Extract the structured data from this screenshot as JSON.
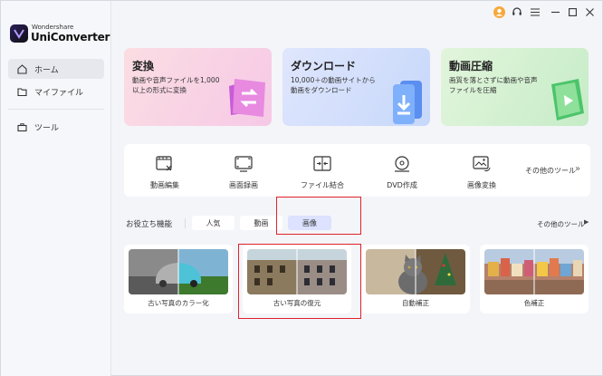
{
  "app": {
    "brand_small": "Wondershare",
    "brand_name": "UniConverter"
  },
  "sidebar": {
    "items": [
      {
        "label": "ホーム",
        "active": true,
        "icon": "home-icon"
      },
      {
        "label": "マイファイル",
        "active": false,
        "icon": "folder-icon"
      },
      {
        "label": "ツール",
        "active": false,
        "icon": "toolbox-icon"
      }
    ]
  },
  "titlebar": {
    "icons": [
      "user-icon",
      "headset-icon",
      "menu-icon",
      "minimize-icon",
      "maximize-icon",
      "close-icon"
    ]
  },
  "feature_cards": [
    {
      "title": "変換",
      "desc": "動画や音声ファイルを1,000以上の形式に変換",
      "bg": "#fbd9e1"
    },
    {
      "title": "ダウンロード",
      "desc": "10,000＋の動画サイトから動画をダウンロード",
      "bg": "#d7e3fb"
    },
    {
      "title": "動画圧縮",
      "desc": "画質を落とさずに動画や音声ファイルを圧縮",
      "bg": "#d8f3d9"
    }
  ],
  "tools": [
    {
      "label": "動画編集",
      "icon": "film-edit-icon"
    },
    {
      "label": "画面録画",
      "icon": "screen-record-icon"
    },
    {
      "label": "ファイル結合",
      "icon": "merge-icon"
    },
    {
      "label": "DVD作成",
      "icon": "dvd-icon"
    },
    {
      "label": "画像変換",
      "icon": "image-convert-icon"
    }
  ],
  "more_tools_label": "その他のツール",
  "useful_features": {
    "label": "お役立ち機能",
    "tabs": [
      {
        "label": "人気",
        "active": false
      },
      {
        "label": "動画",
        "active": false
      },
      {
        "label": "画像",
        "active": true
      }
    ],
    "other_tools_label": "その他のツール"
  },
  "photo_tools": [
    {
      "label": "古い写真のカラー化"
    },
    {
      "label": "古い写真の復元"
    },
    {
      "label": "自動補正"
    },
    {
      "label": "色補正"
    }
  ],
  "colors": {
    "highlight": "#e0222c",
    "active_tab": "#dce2ff",
    "brand_dark": "#2b1e5c"
  }
}
